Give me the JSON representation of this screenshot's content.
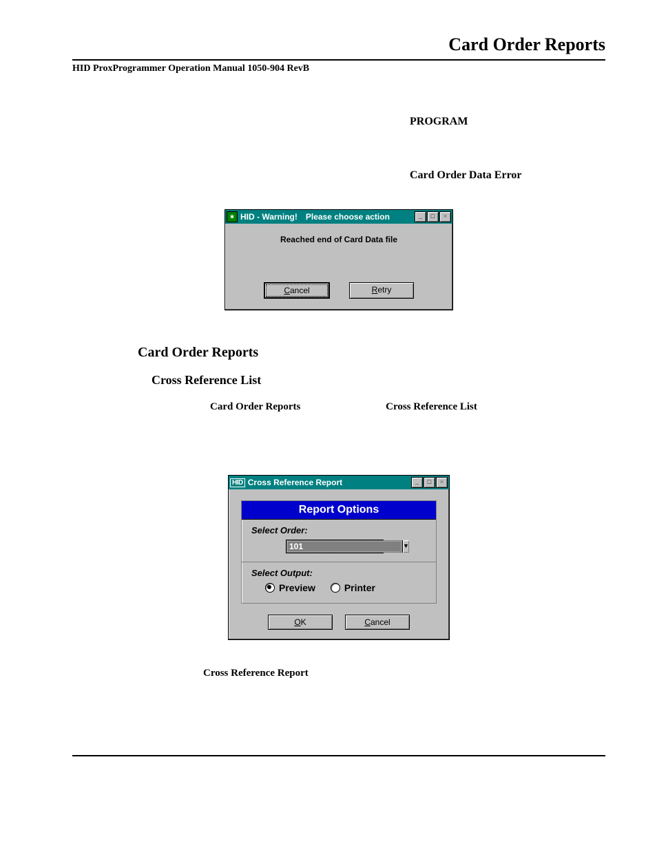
{
  "header": {
    "page_title": "Card Order Reports",
    "manual_line": "HID ProxProgrammer Operation Manual 1050-904 RevB"
  },
  "labels": {
    "program": "PROGRAM",
    "error": "Card Order Data Error",
    "section_reports": "Card Order Reports",
    "section_cross": "Cross Reference List",
    "inline_reports": "Card Order Reports",
    "inline_cross": "Cross Reference List",
    "caption": "Cross Reference Report"
  },
  "warning_dialog": {
    "title_primary": "HID  - Warning!",
    "title_secondary": "Please choose action",
    "message": "Reached end of Card Data file",
    "cancel": "Cancel",
    "retry": "Retry"
  },
  "report_dialog": {
    "title": "Cross Reference Report",
    "options_title": "Report Options",
    "select_order": "Select Order:",
    "order_value": "101",
    "select_output": "Select Output:",
    "preview": "Preview",
    "printer": "Printer",
    "ok": "OK",
    "cancel": "Cancel"
  }
}
